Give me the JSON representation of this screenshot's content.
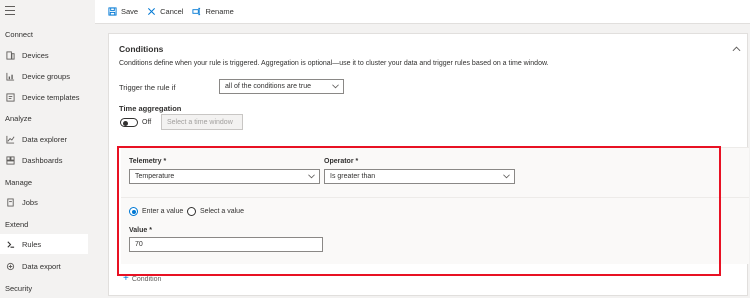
{
  "sidebar": {
    "sections": {
      "connect": "Connect",
      "analyze": "Analyze",
      "manage": "Manage",
      "extend": "Extend",
      "security": "Security"
    },
    "items": [
      {
        "label": "Devices",
        "icon": "devices-icon"
      },
      {
        "label": "Device groups",
        "icon": "device-groups-icon"
      },
      {
        "label": "Device templates",
        "icon": "device-templates-icon"
      },
      {
        "label": "Data explorer",
        "icon": "data-explorer-icon"
      },
      {
        "label": "Dashboards",
        "icon": "dashboards-icon"
      },
      {
        "label": "Jobs",
        "icon": "jobs-icon"
      },
      {
        "label": "Rules",
        "icon": "rules-icon",
        "active": true
      },
      {
        "label": "Data export",
        "icon": "data-export-icon"
      }
    ]
  },
  "toolbar": {
    "save_label": "Save",
    "cancel_label": "Cancel",
    "rename_label": "Rename"
  },
  "conditions": {
    "title": "Conditions",
    "description": "Conditions define when your rule is triggered. Aggregation is optional—use it to cluster your data and trigger rules based on a time window.",
    "trigger_label": "Trigger the rule if",
    "trigger_value": "all of the conditions are true",
    "time_aggregation_label": "Time aggregation",
    "toggle_state": "Off",
    "time_window_placeholder": "Select a time window",
    "telemetry_label": "Telemetry *",
    "telemetry_value": "Temperature",
    "operator_label": "Operator *",
    "operator_value": "Is greater than",
    "radio_enter": "Enter a value",
    "radio_select": "Select a value",
    "value_label": "Value *",
    "value_value": "70",
    "add_condition_label": "Condition"
  },
  "colors": {
    "accent": "#0078d4",
    "highlight": "#e81123"
  }
}
